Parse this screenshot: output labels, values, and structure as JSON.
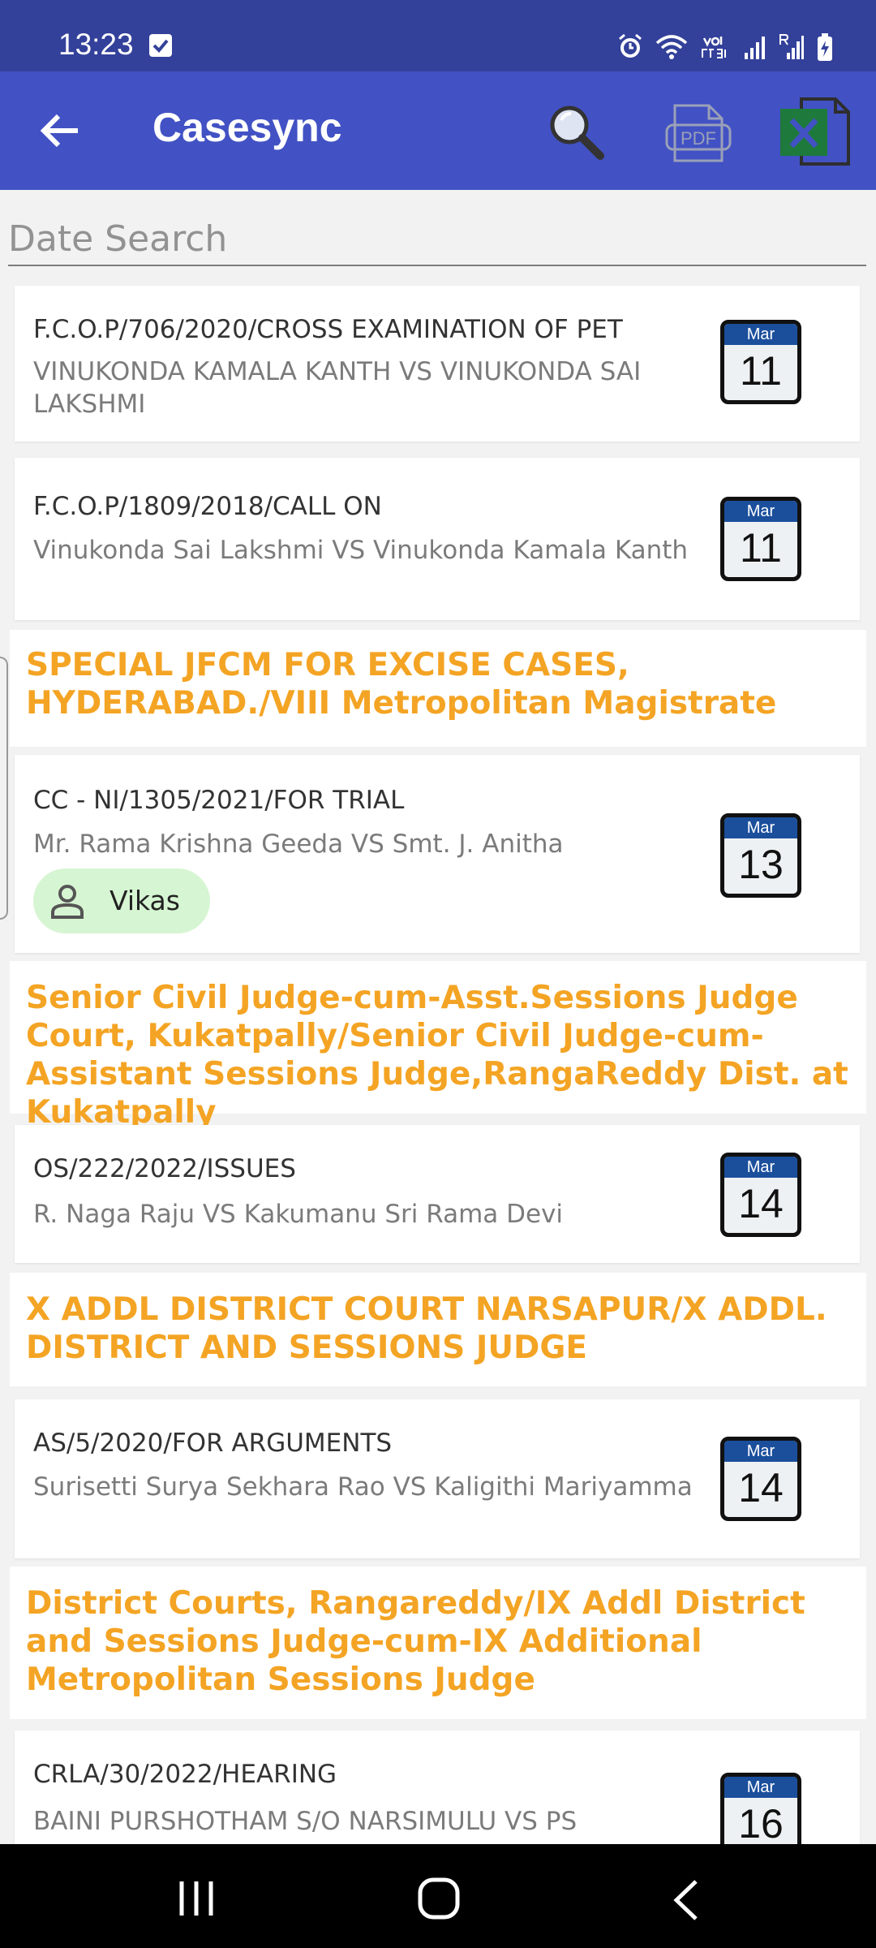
{
  "status_bar": {
    "time": "13:23"
  },
  "app_bar": {
    "title": "Casesync"
  },
  "search": {
    "placeholder": "Date Search"
  },
  "cases": [
    {
      "case_no": "F.C.O.P/706/2020/CROSS EXAMINATION OF PET",
      "parties": "VINUKONDA KAMALA KANTH VS VINUKONDA SAI LAKSHMI",
      "month": "Mar",
      "day": "11"
    },
    {
      "case_no": "F.C.O.P/1809/2018/CALL ON",
      "parties": "Vinukonda Sai Lakshmi VS Vinukonda Kamala Kanth",
      "month": "Mar",
      "day": "11"
    },
    {
      "case_no": "CC - NI/1305/2021/FOR TRIAL",
      "parties": "Mr. Rama Krishna Geeda VS Smt. J. Anitha",
      "month": "Mar",
      "day": "13",
      "assignee": "Vikas"
    },
    {
      "case_no": "OS/222/2022/ISSUES",
      "parties": "R. Naga Raju VS Kakumanu Sri Rama Devi",
      "month": "Mar",
      "day": "14"
    },
    {
      "case_no": "AS/5/2020/FOR ARGUMENTS",
      "parties": "Surisetti Surya Sekhara Rao VS Kaligithi Mariyamma",
      "month": "Mar",
      "day": "14"
    },
    {
      "case_no": "CRLA/30/2022/HEARING",
      "parties": "BAINI PURSHOTHAM S/O NARSIMULU VS PS",
      "month": "Mar",
      "day": "16"
    }
  ],
  "courts": [
    "SPECIAL JFCM FOR EXCISE CASES, HYDERABAD./VIII Metropolitan Magistrate",
    "Senior Civil Judge-cum-Asst.Sessions Judge Court, Kukatpally/Senior Civil Judge-cum-Assistant Sessions Judge,RangaReddy Dist. at Kukatpally",
    "X ADDL DISTRICT COURT NARSAPUR/X ADDL. DISTRICT AND SESSIONS JUDGE",
    "District Courts, Rangareddy/IX Addl District and Sessions Judge-cum-IX Additional Metropolitan Sessions Judge"
  ],
  "icons": {
    "back": "arrow-left-icon",
    "search": "search-icon",
    "pdf": "pdf-icon",
    "excel": "excel-icon",
    "person": "person-icon",
    "calendar": "calendar-icon"
  },
  "colors": {
    "status_bar": "#33419a",
    "app_bar": "#4252c4",
    "court_text": "#f4a424",
    "chip_bg": "#d6f5d2",
    "calendar_header": "#1b4f9c",
    "excel_green": "#1e7a3c"
  }
}
